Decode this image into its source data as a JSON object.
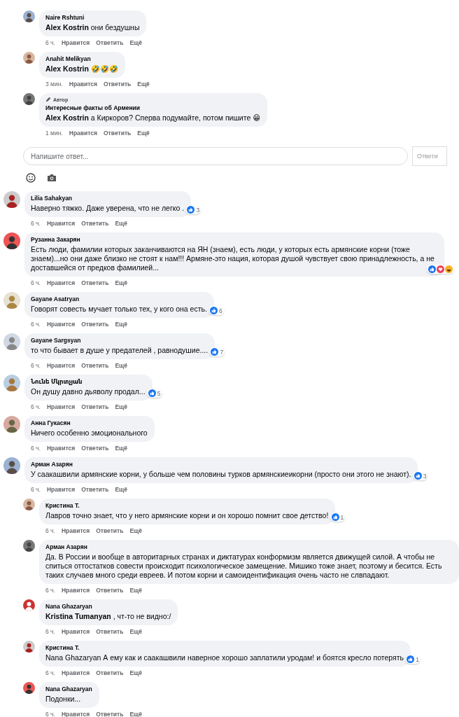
{
  "comments": [
    {
      "kind": "reply",
      "author": "Naire Rshtuni",
      "mention": "Alex Kostrin",
      "text": "они бездушны",
      "time": "6 ч.",
      "actions": [
        "Нравится",
        "Ответить",
        "Ещё"
      ]
    },
    {
      "kind": "reply",
      "author": "Anahit Melikyan",
      "mention": "Alex Kostrin",
      "text": "🤣🤣🤣",
      "time": "3 мин.",
      "actions": [
        "Нравится",
        "Ответить",
        "Ещё"
      ]
    },
    {
      "kind": "reply",
      "badge": "Автор",
      "author": "Интересные факты об Армении",
      "mention": "Alex Kostrin",
      "text": "а Киркоров? Сперва подумайте, потом пишите 😁",
      "time": "1 мин.",
      "actions": [
        "Нравится",
        "Ответить",
        "Ещё"
      ]
    },
    {
      "kind": "composer",
      "placeholder": "Напишите ответ...",
      "button": "Ответи"
    },
    {
      "kind": "top",
      "author": "Lilia Sahakyan",
      "text": "Наверно тяжко. Даже уверена, что не легко .",
      "reaction": {
        "like": true,
        "count": "3"
      },
      "time": "6 ч.",
      "actions": [
        "Нравится",
        "Ответить",
        "Ещё"
      ]
    },
    {
      "kind": "top",
      "author": "Рузанна Закарян",
      "text": "Есть люди, фамилии которых заканчиваются на ЯН (знаем), есть люди, у которых есть армянские корни (тоже знаем)...но они даже близко не стоят к нам!!! Армяне-это нация, которая душой чувствует свою принадлежность, а не доставшейся от предков фамилией...",
      "reaction": {
        "like": true,
        "love": true,
        "haha": true
      },
      "time": "6 ч.",
      "actions": [
        "Нравится",
        "Ответить",
        "Ещё"
      ]
    },
    {
      "kind": "top",
      "author": "Gayane Asatryan",
      "text": "Говорят совесть мучает только тех, у кого она есть.",
      "reaction": {
        "like": true,
        "count": "6"
      },
      "time": "6 ч.",
      "actions": [
        "Нравится",
        "Ответить",
        "Ещё"
      ]
    },
    {
      "kind": "top",
      "author": "Gayane Sargsyan",
      "text": "то что бывает в душе у предателей , равнодушие....",
      "reaction": {
        "like": true,
        "count": "7"
      },
      "time": "6 ч.",
      "actions": [
        "Нравится",
        "Ответить",
        "Ещё"
      ]
    },
    {
      "kind": "top",
      "author": "Նունե Մկրտչյան",
      "text": "Он душу давно дьяволу продал...",
      "reaction": {
        "like": true,
        "count": "5"
      },
      "time": "6 ч.",
      "actions": [
        "Нравится",
        "Ответить",
        "Ещё"
      ]
    },
    {
      "kind": "top",
      "author": "Анна Гукасян",
      "text": "Ничего особенно эмоционального",
      "time": "6 ч.",
      "actions": [
        "Нравится",
        "Ответить",
        "Ещё"
      ]
    },
    {
      "kind": "top",
      "author": "Арман Азарян",
      "text": "У саакашвили армянские корни, у больше чем половины турков армянскиеикорни (просто они этого не знают).",
      "reaction": {
        "like": true,
        "count": "3"
      },
      "time": "6 ч.",
      "actions": [
        "Нравится",
        "Ответить",
        "Ещё"
      ]
    },
    {
      "kind": "reply",
      "author": "Кристина Т.",
      "text": "Лавров точно знает, что у него армянские корни и он хорошо помнит свое детство!",
      "reaction": {
        "like": true,
        "count": "1"
      },
      "time": "6 ч.",
      "actions": [
        "Нравится",
        "Ответить",
        "Ещё"
      ]
    },
    {
      "kind": "reply",
      "author": "Арман Азарян",
      "text": "Да. В России и вообще в авторитарных странах и диктатурах конформизм является движущей силой. А чтобы не спиться оттостатков совести происходит психологическое замещение. Мишико тоже знает, поэтому и бесится. Есть таких случаев много среди евреев. И потом корни и самоидентификация очень часто не слвпадают.",
      "time": "6 ч.",
      "actions": [
        "Нравится",
        "Ответить",
        "Ещё"
      ]
    },
    {
      "kind": "reply",
      "author": "Nana Ghazaryan",
      "mention": "Kristina Tumanyan",
      "text": ", чт-то не видно:/",
      "time": "6 ч.",
      "actions": [
        "Нравится",
        "Ответить",
        "Ещё"
      ]
    },
    {
      "kind": "reply",
      "author": "Кристина Т.",
      "text": "Nana Ghazaryan А ему как и саакашвили наверное хорошо заплатили уродам! и боятся кресло потерять",
      "reaction": {
        "like": true,
        "count": "1"
      },
      "time": "6 ч.",
      "actions": [
        "Нравится",
        "Ответить",
        "Ещё"
      ]
    },
    {
      "kind": "reply",
      "author": "Nana Ghazaryan",
      "text": "Подонки...",
      "time": "6 ч.",
      "actions": [
        "Нравится",
        "Ответить",
        "Ещё"
      ]
    }
  ]
}
